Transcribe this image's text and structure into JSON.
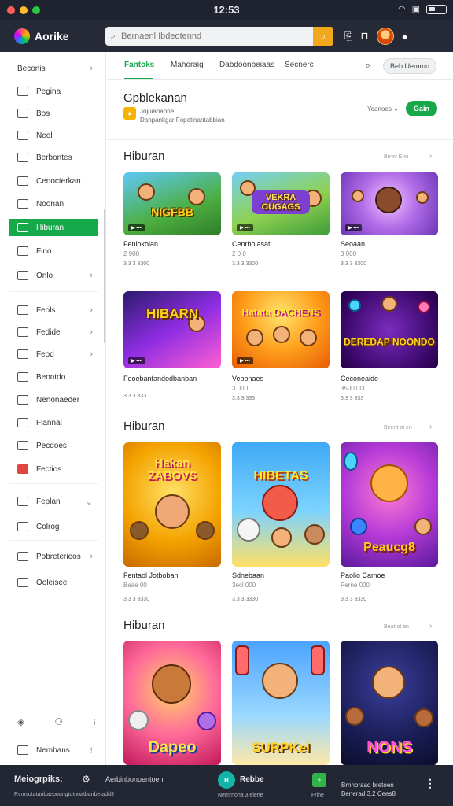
{
  "window": {
    "clock": "12:53"
  },
  "app": {
    "name": "Aorike"
  },
  "search": {
    "placeholder": "Bernaenl Ibdeotennd"
  },
  "sidebar": {
    "items": [
      {
        "label": "Beconis",
        "icon": "chevron-right-icon",
        "active": false
      },
      {
        "label": "Pegina",
        "icon": "page-icon",
        "active": false
      },
      {
        "label": "Bos",
        "icon": "game-icon",
        "active": false
      },
      {
        "label": "Neol",
        "icon": "home-icon",
        "active": false
      },
      {
        "label": "Berbontes",
        "icon": "list-icon",
        "active": false
      },
      {
        "label": "Cenocterkan",
        "icon": "category-icon",
        "active": false
      },
      {
        "label": "Noonan",
        "icon": "monitor-icon",
        "active": false
      },
      {
        "label": "Hiburan",
        "icon": "entertainment-icon",
        "active": true
      },
      {
        "label": "Fino",
        "icon": "file-icon",
        "active": false
      },
      {
        "label": "Onlo",
        "icon": "globe-icon",
        "active": false
      },
      {
        "label": "Feols",
        "icon": "grid-icon",
        "active": false
      },
      {
        "label": "Fedide",
        "icon": "play-icon",
        "active": false
      },
      {
        "label": "Feod",
        "icon": "feed-icon",
        "active": false
      },
      {
        "label": "Beontdo",
        "icon": "tag-icon",
        "active": false
      },
      {
        "label": "Nenonaeder",
        "icon": "clock-icon",
        "active": false
      },
      {
        "label": "Flannal",
        "icon": "book-icon",
        "active": false
      },
      {
        "label": "Pecdoes",
        "icon": "video-icon",
        "active": false
      },
      {
        "label": "Fectios",
        "icon": "fire-icon",
        "active": false
      },
      {
        "label": "Feplan",
        "icon": "download-icon",
        "active": false
      },
      {
        "label": "Colrog",
        "icon": "history-icon",
        "active": false
      },
      {
        "label": "Pobreterieos",
        "icon": "settings-icon",
        "active": false
      },
      {
        "label": "Ooleisee",
        "icon": "help-icon",
        "active": false
      },
      {
        "label": "Nembans",
        "icon": "user-icon",
        "active": false
      }
    ]
  },
  "tabs": [
    "Fantoks",
    "Mahoraig",
    "Dabdoonbeiaas",
    "Secnerc"
  ],
  "tab_pill": "Beb Uemmn",
  "hero": {
    "title": "Gpblekanan",
    "line1": "Jojuianahne",
    "line2": "Danpankgar Fopetinantabbian",
    "link": "Yeanoes",
    "button": "Gain"
  },
  "sections": [
    {
      "title": "Hiburan",
      "more": "Brrov Enn",
      "cards": [
        {
          "art": "NIGFBB",
          "name": "Fenlokolan",
          "meta": "2 900",
          "rating": "3.3 3 3300"
        },
        {
          "art": "VEKRA OUGAGS",
          "name": "Cenrbolasat",
          "meta": "2 0 0",
          "rating": "3.3 3 3300"
        },
        {
          "art": "",
          "name": "Seoaan",
          "meta": "3 000",
          "rating": "3.3 3 3300"
        }
      ]
    },
    {
      "title": "",
      "more": "",
      "cards": [
        {
          "art": "HIBARN",
          "name": "Feoebanfandodbanban",
          "meta": "",
          "rating": "3.3 3 333"
        },
        {
          "art": "Hatata DACHENS",
          "name": "Vebonaes",
          "meta": "3 000",
          "rating": "3.3 3 333"
        },
        {
          "art": "DEREDAP NOONDO",
          "name": "Ceconeaide",
          "meta": "3500 000",
          "rating": "3.3 3 333"
        }
      ]
    },
    {
      "title": "Hiburan",
      "more": "Beent ot en",
      "cards": [
        {
          "art": "Hakan ZABOVS",
          "name": "Fentaol Jotboban",
          "meta": "Beae 00",
          "rating": "3.3 3 3330"
        },
        {
          "art": "HIBETAS",
          "name": "Sdnebaan",
          "meta": "3ecl 000",
          "rating": "3.3 3 3330"
        },
        {
          "art": "Peaucg8",
          "name": "Paolio Camoe",
          "meta": "Perne 000",
          "rating": "3.3 3 3330"
        }
      ]
    },
    {
      "title": "Hiburan",
      "more": "Beat ot en",
      "cards": [
        {
          "art": "Dapeo",
          "name": "",
          "meta": "",
          "rating": ""
        },
        {
          "art": "SURPKel",
          "name": "",
          "meta": "",
          "rating": ""
        },
        {
          "art": "NONS",
          "name": "",
          "meta": "",
          "rating": ""
        }
      ]
    }
  ],
  "dock": {
    "title": "Meiogrpiks:",
    "sub": "Rvmsotatanbaeboangtotnoatbanbetadd3",
    "middle": "Aerbinbonoentoen",
    "app_badge": "B",
    "app_label": "Rebbe",
    "app_sub": "Nemrnona 3 eiene",
    "sq_label": "Frihe",
    "right_line1": "Brnhoraad bretoen",
    "right_line2": "Benerad 3.2 Cees8"
  },
  "colors": {
    "accent": "#17a84a",
    "header": "#262a36",
    "search_button": "#f1a81d"
  }
}
